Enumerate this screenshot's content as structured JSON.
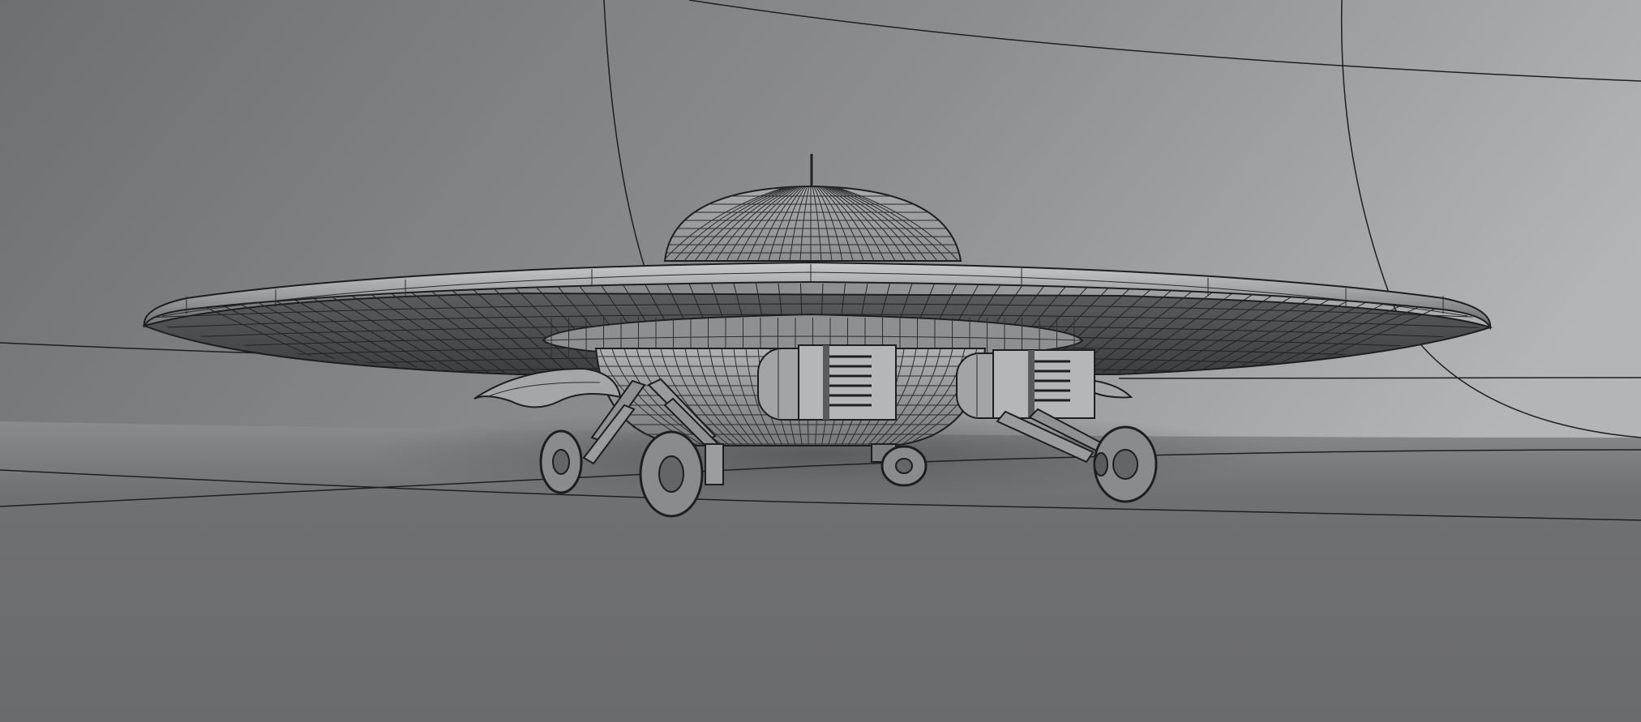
{
  "scene": {
    "type": "3d-wireframe-render",
    "subject": "flying-saucer-with-landing-gear",
    "colors": {
      "backdrop_light": "#b3b4b6",
      "backdrop_dark": "#6c6d6f",
      "floor": "#717274",
      "hull": "#a6a7a9",
      "hull_dark": "#4a4b4d",
      "wire": "#1e1e1f"
    }
  }
}
